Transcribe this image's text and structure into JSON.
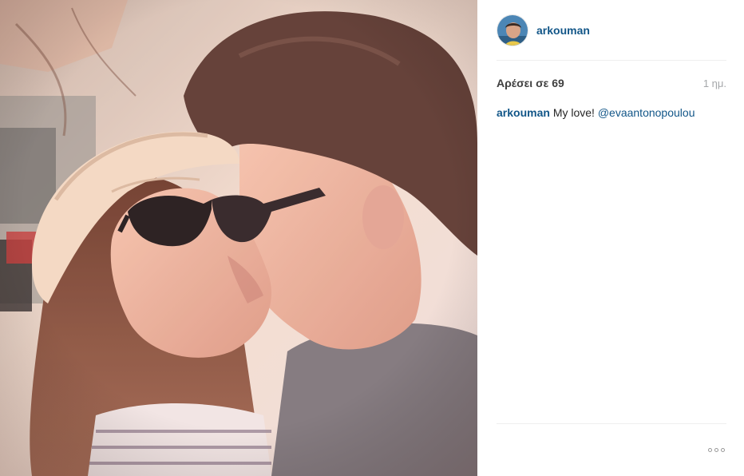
{
  "post": {
    "author": {
      "username": "arkouman"
    },
    "likes_text": "Αρέσει σε 69",
    "time_text": "1 ημ.",
    "caption": {
      "author": "arkouman",
      "text": "My love!",
      "mention": "@evaantonopoulou"
    },
    "more_icon": "ellipsis-icon",
    "colors": {
      "link": "#125688",
      "divider": "#efefef",
      "muted": "#a5a7aa"
    }
  }
}
